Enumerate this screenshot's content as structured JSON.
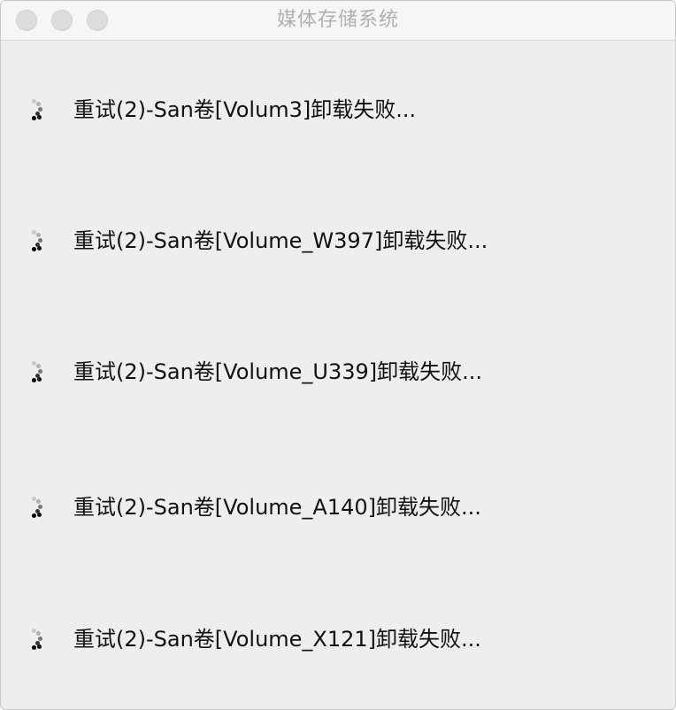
{
  "window": {
    "title": "媒体存储系统"
  },
  "tasks": [
    {
      "label": "重试(2)-San卷[Volum3]卸载失败...",
      "icon": "loading-spinner-icon"
    },
    {
      "label": "重试(2)-San卷[Volume_W397]卸载失败...",
      "icon": "loading-spinner-icon"
    },
    {
      "label": "重试(2)-San卷[Volume_U339]卸载失败...",
      "icon": "loading-spinner-icon"
    },
    {
      "label": "重试(2)-San卷[Volume_A140]卸载失败...",
      "icon": "loading-spinner-icon"
    },
    {
      "label": "重试(2)-San卷[Volume_X121]卸载失败...",
      "icon": "loading-spinner-icon"
    }
  ]
}
